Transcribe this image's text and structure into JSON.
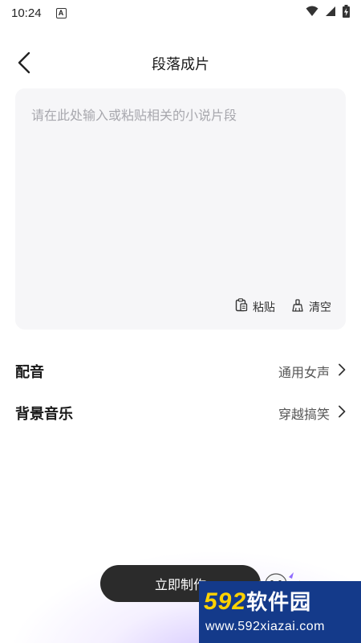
{
  "status_bar": {
    "time": "10:24",
    "notification_letter": "A",
    "icons": [
      "wifi-icon",
      "signal-icon",
      "battery-charging-icon"
    ]
  },
  "header": {
    "title": "段落成片",
    "back_icon": "chevron-left-icon"
  },
  "editor": {
    "placeholder": "请在此处输入或粘贴相关的小说片段",
    "value": "",
    "paste_label": "粘贴",
    "clear_label": "清空",
    "paste_icon": "clipboard-icon",
    "clear_icon": "broom-icon"
  },
  "settings": [
    {
      "label": "配音",
      "value": "通用女声"
    },
    {
      "label": "背景音乐",
      "value": "穿越搞笑"
    }
  ],
  "cta": {
    "label": "立即制作"
  },
  "watermark": {
    "brand_number": "592",
    "brand_text": "软件园",
    "url": "www.592xiazai.com"
  },
  "colors": {
    "editor_bg": "#f6f6f8",
    "button_bg": "#2b2b2b",
    "watermark_bg": "#143a8a",
    "watermark_accent": "#ffd200",
    "glow": "#c4b2ff"
  }
}
